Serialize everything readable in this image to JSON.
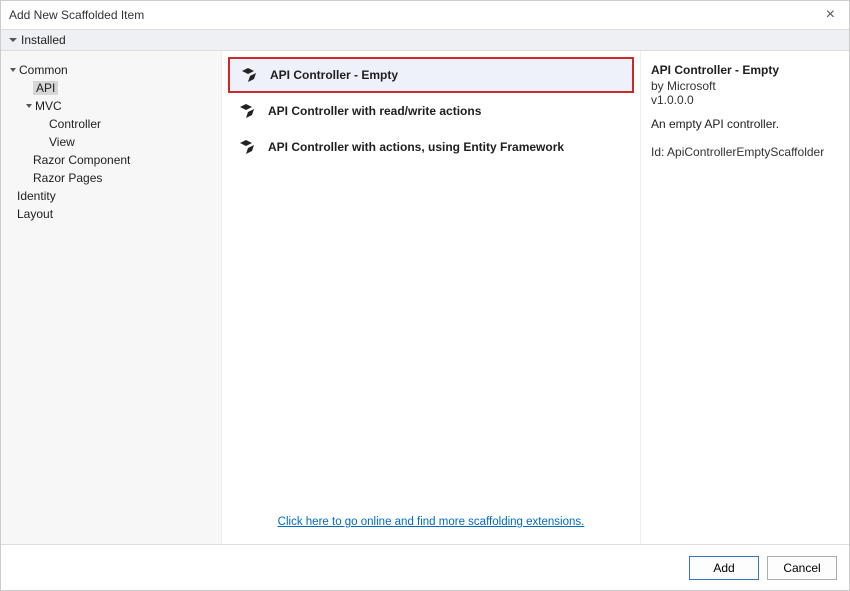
{
  "window": {
    "title": "Add New Scaffolded Item"
  },
  "breadcrumb": {
    "installed": "Installed"
  },
  "tree": {
    "common": "Common",
    "api": "API",
    "mvc": "MVC",
    "controller": "Controller",
    "view": "View",
    "razor_component": "Razor Component",
    "razor_pages": "Razor Pages",
    "identity": "Identity",
    "layout": "Layout"
  },
  "items": [
    {
      "label": "API Controller - Empty",
      "selected": true
    },
    {
      "label": "API Controller with read/write actions",
      "selected": false
    },
    {
      "label": "API Controller with actions, using Entity Framework",
      "selected": false
    }
  ],
  "link": {
    "text": "Click here to go online and find more scaffolding extensions."
  },
  "details": {
    "name": "API Controller - Empty",
    "by": "by Microsoft",
    "version": "v1.0.0.0",
    "description": "An empty API controller.",
    "id": "Id: ApiControllerEmptyScaffolder"
  },
  "buttons": {
    "add": "Add",
    "cancel": "Cancel"
  }
}
